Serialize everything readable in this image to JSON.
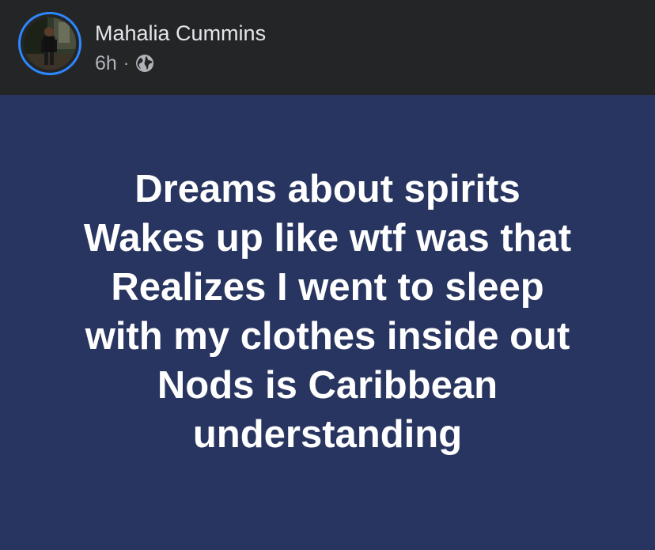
{
  "post": {
    "author": "Mahalia Cummins",
    "time": "6h",
    "separator": "·",
    "privacy_icon": "globe-icon",
    "lines": [
      "Dreams about spirits",
      "Wakes up like wtf was that",
      "Realizes I went to sleep",
      "with my clothes inside out",
      "Nods is Caribbean",
      "understanding"
    ]
  },
  "colors": {
    "header_bg": "#242526",
    "body_bg": "#283560",
    "story_ring": "#2d88ff",
    "name_text": "#e4e6eb",
    "meta_text": "#b0b3b8",
    "post_text": "#ffffff"
  }
}
